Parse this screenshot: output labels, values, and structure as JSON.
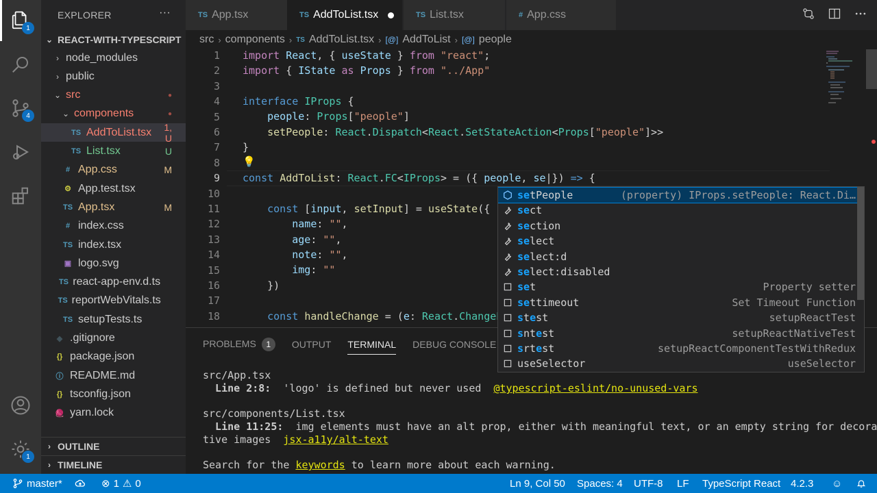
{
  "activity": {
    "explorer_badge": "1",
    "scm_badge": "4",
    "settings_badge": "1"
  },
  "sidebar": {
    "title": "EXPLORER",
    "more": "···",
    "root": "REACT-WITH-TYPESCRIPT",
    "items": [
      {
        "label": "node_modules",
        "icon": "",
        "status": ""
      },
      {
        "label": "public",
        "icon": "",
        "status": ""
      },
      {
        "label": "src",
        "icon": "",
        "status": "●"
      },
      {
        "label": "components",
        "icon": "",
        "status": "●"
      },
      {
        "label": "AddToList.tsx",
        "icon": "TS",
        "status": "1, U"
      },
      {
        "label": "List.tsx",
        "icon": "TS",
        "status": "U"
      },
      {
        "label": "App.css",
        "icon": "#",
        "status": "M"
      },
      {
        "label": "App.test.tsx",
        "icon": "⚙",
        "status": ""
      },
      {
        "label": "App.tsx",
        "icon": "TS",
        "status": "M"
      },
      {
        "label": "index.css",
        "icon": "#",
        "status": ""
      },
      {
        "label": "index.tsx",
        "icon": "TS",
        "status": ""
      },
      {
        "label": "logo.svg",
        "icon": "▣",
        "status": ""
      },
      {
        "label": "react-app-env.d.ts",
        "icon": "TS",
        "status": ""
      },
      {
        "label": "reportWebVitals.ts",
        "icon": "TS",
        "status": ""
      },
      {
        "label": "setupTests.ts",
        "icon": "TS",
        "status": ""
      },
      {
        "label": ".gitignore",
        "icon": "◆",
        "status": ""
      },
      {
        "label": "package.json",
        "icon": "{}",
        "status": ""
      },
      {
        "label": "README.md",
        "icon": "ⓘ",
        "status": ""
      },
      {
        "label": "tsconfig.json",
        "icon": "{}",
        "status": ""
      },
      {
        "label": "yarn.lock",
        "icon": "🧶",
        "status": ""
      }
    ],
    "outline": "OUTLINE",
    "timeline": "TIMELINE"
  },
  "tabs": [
    {
      "icon": "TS",
      "label": "App.tsx"
    },
    {
      "icon": "TS",
      "label": "AddToList.tsx"
    },
    {
      "icon": "TS",
      "label": "List.tsx"
    },
    {
      "icon": "#",
      "label": "App.css"
    }
  ],
  "breadcrumb": {
    "src": "src",
    "components": "components",
    "file_icon": "TS",
    "file": "AddToList.tsx",
    "component_icon": "[@]",
    "component": "AddToList",
    "prop_icon": "[@]",
    "prop": "people"
  },
  "editor": {
    "line_numbers": [
      "1",
      "2",
      "3",
      "4",
      "5",
      "6",
      "7",
      "8",
      "9",
      "10",
      "11",
      "12",
      "13",
      "14",
      "15",
      "16",
      "17",
      "18"
    ],
    "current_line": "9"
  },
  "suggest": [
    {
      "match": "se",
      "rest": "tPeople",
      "detail": "(property) IProps.setPeople: React.Di…",
      "kind": "property"
    },
    {
      "match": "se",
      "rest": "ct",
      "detail": "",
      "kind": "emmet"
    },
    {
      "match": "se",
      "rest": "ction",
      "detail": "",
      "kind": "emmet"
    },
    {
      "match": "se",
      "rest": "lect",
      "detail": "",
      "kind": "emmet"
    },
    {
      "match": "se",
      "rest": "lect:d",
      "detail": "",
      "kind": "emmet"
    },
    {
      "match": "se",
      "rest": "lect:disabled",
      "detail": "",
      "kind": "emmet"
    },
    {
      "match": "se",
      "rest": "t",
      "detail": "Property setter",
      "kind": "snippet"
    },
    {
      "match": "se",
      "rest": "ttimeout",
      "detail": "Set Timeout Function",
      "kind": "snippet"
    },
    {
      "match": "s",
      "rest": "t|e|st",
      "detail": "setupReactTest",
      "kind": "snippet"
    },
    {
      "match": "s",
      "rest": "nt|e|st",
      "detail": "setupReactNativeTest",
      "kind": "snippet"
    },
    {
      "match": "s",
      "rest": "rt|e|st",
      "detail": "setupReactComponentTestWithRedux",
      "kind": "snippet"
    },
    {
      "match": "",
      "rest": "useSelector",
      "detail": "useSelector",
      "kind": "snippet"
    }
  ],
  "panel": {
    "tabs": [
      "PROBLEMS",
      "OUTPUT",
      "TERMINAL",
      "DEBUG CONSOLE"
    ],
    "problems_count": "1",
    "terminal": {
      "file1": "src/App.tsx",
      "loc1": "  Line 2:8:",
      "msg1": "  'logo' is defined but never used  ",
      "rule1": "@typescript-eslint/no-unused-vars",
      "file2": "src/components/List.tsx",
      "loc2": "  Line 11:25:",
      "msg2": "  img elements must have an alt prop, either with meaningful text, or an empty string for decora",
      "msg2b": "tive images  ",
      "rule2": "jsx-a11y/alt-text",
      "search_pre": "Search for the ",
      "search_kw": "keywords",
      "search_post": " to learn more about each warning."
    }
  },
  "status": {
    "branch": "master*",
    "errors": "1",
    "warnings": "0",
    "position": "Ln 9, Col 50",
    "spaces": "Spaces: 4",
    "encoding": "UTF-8",
    "eol": "LF",
    "language": "TypeScript React",
    "version": "4.2.3"
  },
  "colors": {
    "accent": "#007acc",
    "modified": "#e2c08d",
    "untracked": "#73c991",
    "error_file": "#f88070"
  }
}
